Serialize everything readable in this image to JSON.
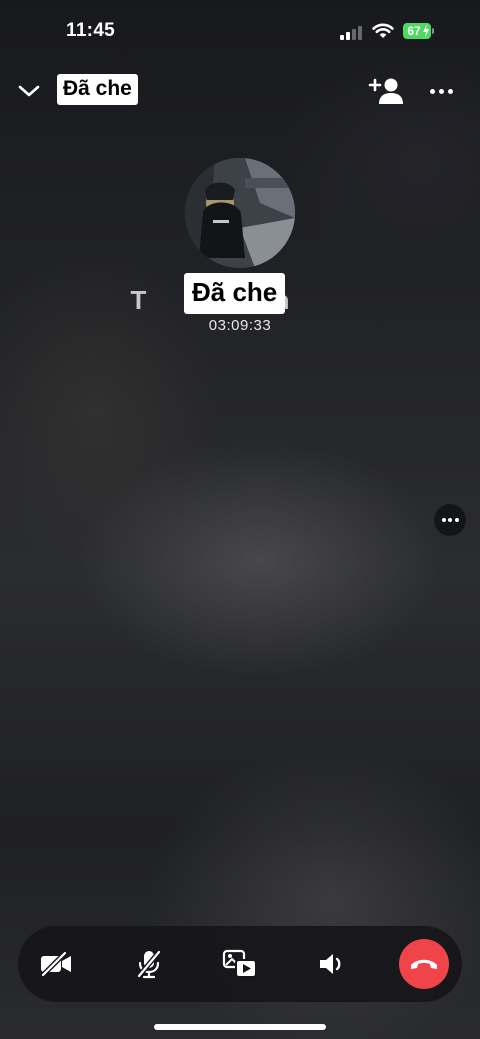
{
  "status_bar": {
    "time": "11:45",
    "battery": "67",
    "battery_color": "#4cd964"
  },
  "header": {
    "collapse_icon": "chevron-down-icon",
    "contact_name": "Đã che",
    "add_person_icon": "add-person-icon",
    "more_icon": "more-horizontal-icon"
  },
  "call": {
    "avatar": "contact-avatar",
    "ghost_name": "T n",
    "contact_name": "Đã che",
    "duration": "03:09:33"
  },
  "side_more_icon": "more-horizontal-icon",
  "controls": {
    "items": [
      {
        "name": "camera-off-button",
        "icon": "video-off-icon"
      },
      {
        "name": "mute-button",
        "icon": "mic-off-icon"
      },
      {
        "name": "switch-media-button",
        "icon": "media-switch-icon"
      },
      {
        "name": "speaker-button",
        "icon": "speaker-icon"
      },
      {
        "name": "end-call-button",
        "icon": "phone-hangup-icon"
      }
    ],
    "end_call_color": "#f0444b"
  }
}
